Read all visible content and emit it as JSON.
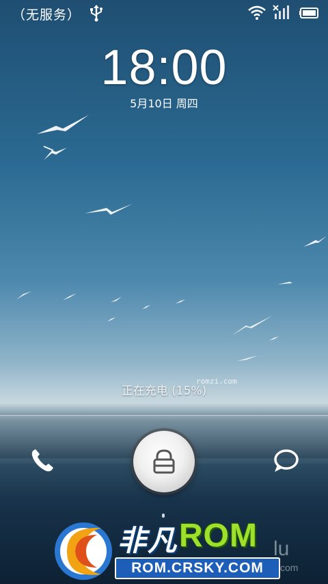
{
  "status_bar": {
    "carrier": "（无服务）",
    "icons": [
      "usb-icon",
      "wifi-icon",
      "no-signal-icon",
      "battery-icon"
    ]
  },
  "lock_screen": {
    "time": "18:00",
    "date": "5月10日 周四",
    "charging_status": "正在充电 (15%)",
    "watermark_small": "romzi.com"
  },
  "dock": {
    "left_icon": "phone-icon",
    "center_icon": "unlock-lock-icon",
    "right_icon": "message-bubble-icon"
  },
  "overlay_logo": {
    "brand_cn": "非凡",
    "brand_rom": "ROM",
    "url": "ROM.CRSKY.COM",
    "ghost_text": "lu",
    "ghost_text2": "com"
  },
  "colors": {
    "sky_top": "#1f4e72",
    "sea": "#17324a",
    "rom_green": "#9ee02b",
    "url_blue": "#1d5fb8"
  }
}
